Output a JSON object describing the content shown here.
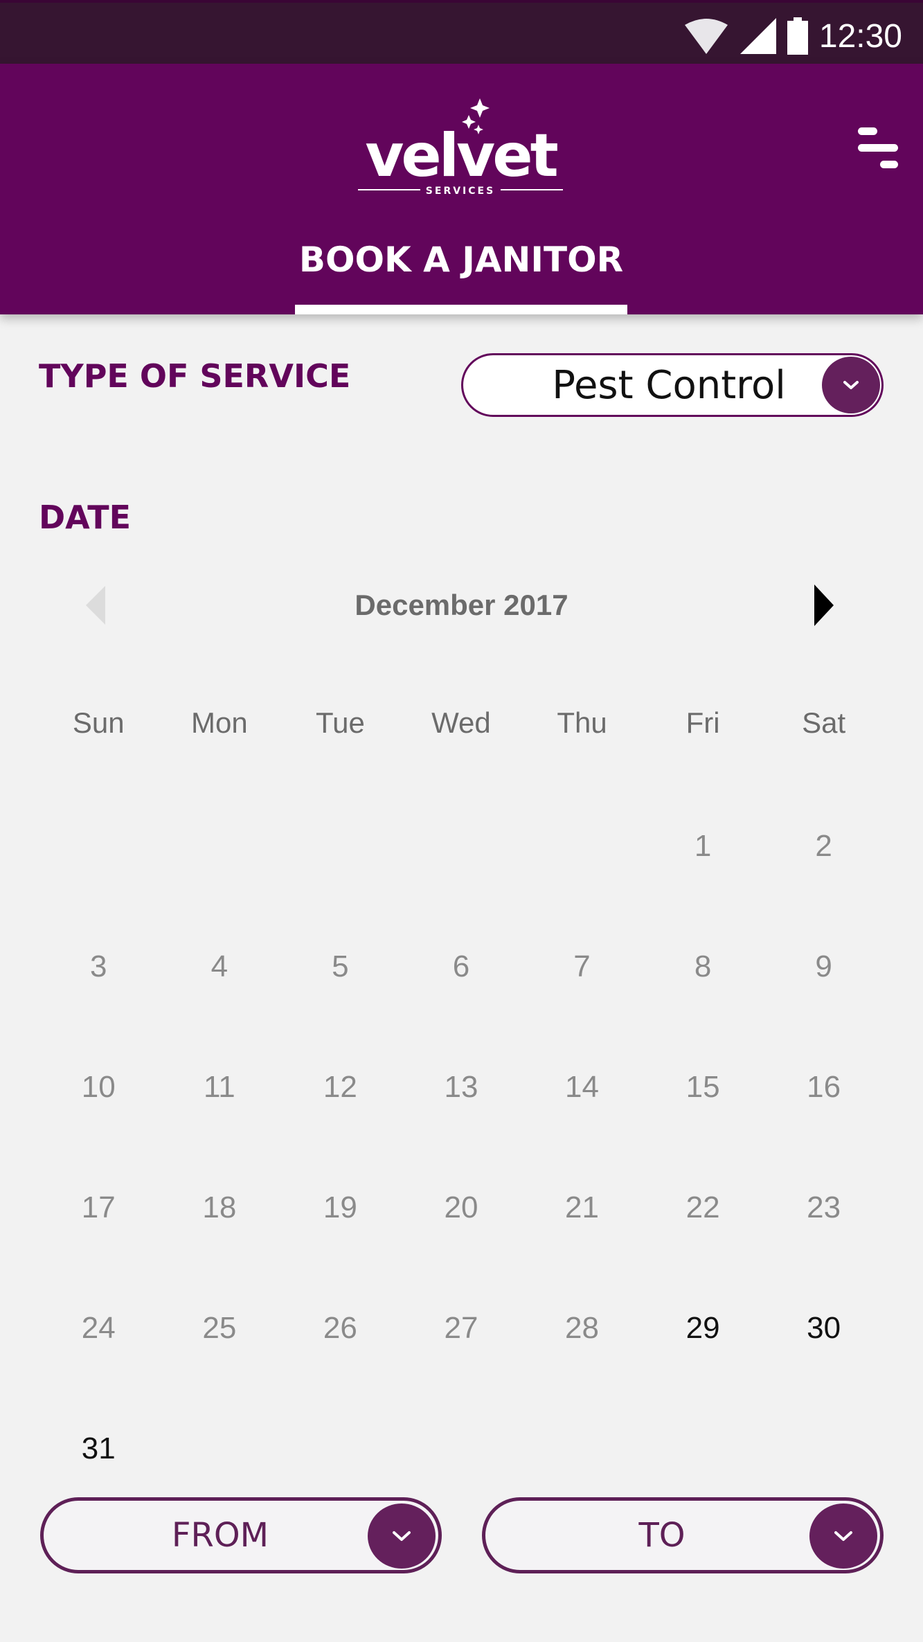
{
  "status_bar": {
    "time": "12:30",
    "icons": [
      "wifi-icon",
      "cellular-signal-icon",
      "battery-icon"
    ]
  },
  "header": {
    "logo_text": "velvet",
    "logo_subtext": "SERVICES",
    "menu_icon": "menu-icon",
    "tab_label": "BOOK A JANITOR",
    "brand_color": "#62055b"
  },
  "service": {
    "label": "TYPE OF SERVICE",
    "selected": "Pest Control"
  },
  "date": {
    "label": "DATE",
    "month_title": "December 2017",
    "weekdays": [
      "Sun",
      "Mon",
      "Tue",
      "Wed",
      "Thu",
      "Fri",
      "Sat"
    ],
    "weeks": [
      [
        null,
        null,
        null,
        null,
        null,
        {
          "d": "1",
          "available": false
        },
        {
          "d": "2",
          "available": false
        }
      ],
      [
        {
          "d": "3",
          "available": false
        },
        {
          "d": "4",
          "available": false
        },
        {
          "d": "5",
          "available": false
        },
        {
          "d": "6",
          "available": false
        },
        {
          "d": "7",
          "available": false
        },
        {
          "d": "8",
          "available": false
        },
        {
          "d": "9",
          "available": false
        }
      ],
      [
        {
          "d": "10",
          "available": false
        },
        {
          "d": "11",
          "available": false
        },
        {
          "d": "12",
          "available": false
        },
        {
          "d": "13",
          "available": false
        },
        {
          "d": "14",
          "available": false
        },
        {
          "d": "15",
          "available": false
        },
        {
          "d": "16",
          "available": false
        }
      ],
      [
        {
          "d": "17",
          "available": false
        },
        {
          "d": "18",
          "available": false
        },
        {
          "d": "19",
          "available": false
        },
        {
          "d": "20",
          "available": false
        },
        {
          "d": "21",
          "available": false
        },
        {
          "d": "22",
          "available": false
        },
        {
          "d": "23",
          "available": false
        }
      ],
      [
        {
          "d": "24",
          "available": false
        },
        {
          "d": "25",
          "available": false
        },
        {
          "d": "26",
          "available": false
        },
        {
          "d": "27",
          "available": false
        },
        {
          "d": "28",
          "available": false
        },
        {
          "d": "29",
          "available": true
        },
        {
          "d": "30",
          "available": true
        }
      ],
      [
        {
          "d": "31",
          "available": true
        },
        null,
        null,
        null,
        null,
        null,
        null
      ]
    ]
  },
  "time_range": {
    "from_label": "FROM",
    "to_label": "TO"
  }
}
